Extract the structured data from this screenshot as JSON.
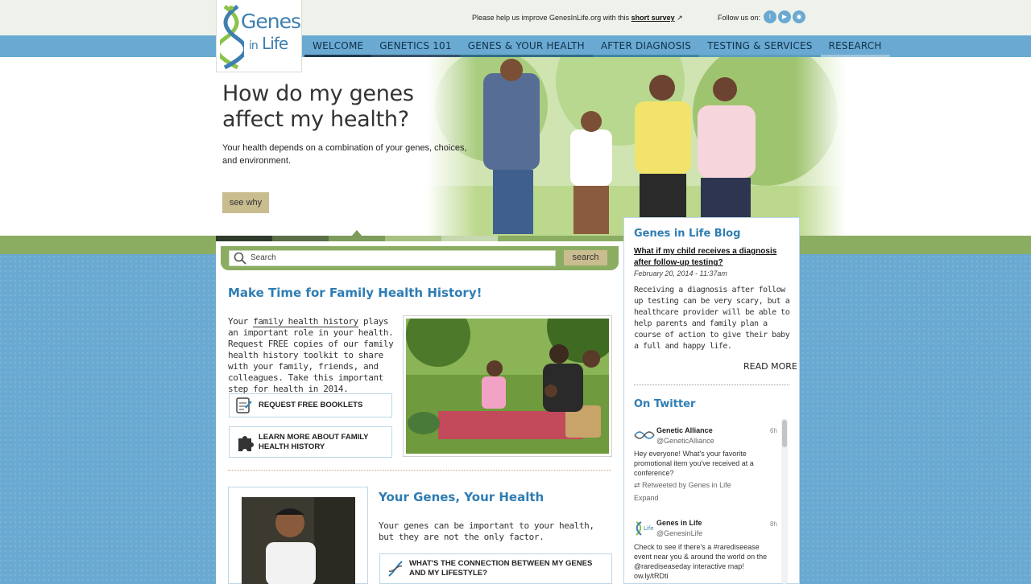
{
  "logo": {
    "line1": "Genes",
    "line2_small": "in",
    "line2": "Life"
  },
  "survey": {
    "text": "Please help us improve GenesInLife.org with this",
    "link": "short survey"
  },
  "social": {
    "label": "Follow us on:",
    "icons": [
      "twitter-icon",
      "youtube-icon",
      "rss-icon"
    ]
  },
  "nav": [
    "WELCOME",
    "GENETICS 101",
    "GENES & YOUR HEALTH",
    "AFTER DIAGNOSIS",
    "TESTING & SERVICES",
    "RESEARCH"
  ],
  "hero": {
    "title": "How do my genes affect my health?",
    "text": "Your health depends on a combination of your genes, choices, and environment.",
    "button": "see why"
  },
  "search": {
    "placeholder": "Search",
    "button": "search"
  },
  "family": {
    "title": "Make Time for Family Health History!",
    "text_pre": "Your ",
    "text_link": "family health history",
    "text_post": " plays an important role in your health. Request FREE copies of our family health history toolkit to share with your family, friends, and colleagues. Take this important step for health in 2014.",
    "btn1": "REQUEST FREE BOOKLETS",
    "btn2": "LEARN MORE ABOUT FAMILY HEALTH HISTORY"
  },
  "genes": {
    "title": "Your Genes, Your Health",
    "text": "Your genes can be important to your health, but they are not the only factor.",
    "btn": "WHAT'S THE CONNECTION BETWEEN MY GENES AND MY LIFESTYLE?"
  },
  "blog": {
    "title": "Genes in Life Blog",
    "question": "What if my child receives a diagnosis after follow-up testing?",
    "date": "February 20, 2014 - 11:37am",
    "text": "Receiving a diagnosis after follow up testing can be very scary, but a healthcare provider will be able to help parents and family plan a course of action to give their baby a full and happy life.",
    "read_more": "READ MORE"
  },
  "twitter": {
    "title": "On Twitter",
    "tweets": [
      {
        "name": "Genetic Alliance",
        "handle": "@GeneticAlliance",
        "time": "6h",
        "text": "Hey everyone! What's your favorite promotional item you've received at a conference?",
        "retweet": "Retweeted by Genes in Life",
        "expand": "Expand"
      },
      {
        "name": "Genes in Life",
        "handle": "@GenesinLife",
        "time": "8h",
        "text": "Check to see if there's a #rarediseease event near you & around the world on the @rarediseaseday interactive map! ow.ly/tRDti"
      }
    ]
  },
  "colors": {
    "accent_blue": "#2f7db3",
    "green": "#8aad62",
    "tan": "#c9bc8f",
    "sky": "#6aa9d2"
  }
}
